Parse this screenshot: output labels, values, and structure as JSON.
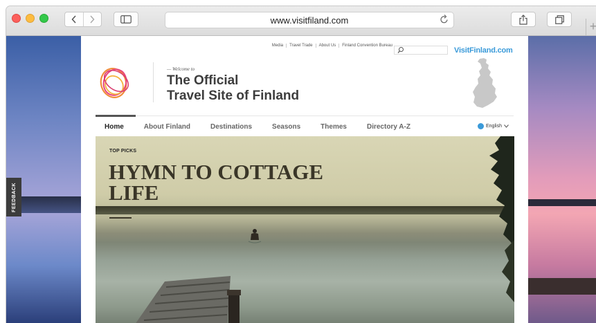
{
  "browser": {
    "url": "www.visitfiland.com",
    "new_tab": "+"
  },
  "page": {
    "feedback_label": "FEEDBACK",
    "top_links": [
      "Media",
      "Travel Trade",
      "About Us",
      "Finland Convention Bureau"
    ],
    "brand": "VisitFinland.com",
    "welcome": "— Welcome to",
    "title_line1": "The Official",
    "title_line2": "Travel Site of Finland",
    "nav": [
      "Home",
      "About Finland",
      "Destinations",
      "Seasons",
      "Themes",
      "Directory A-Z"
    ],
    "nav_active": "Home",
    "language": "English",
    "hero": {
      "kicker": "TOP PICKS",
      "title": "HYMN TO COTTAGE LIFE"
    }
  },
  "colors": {
    "brand_blue": "#3a9ad9",
    "title_gray": "#3d3d3d"
  }
}
